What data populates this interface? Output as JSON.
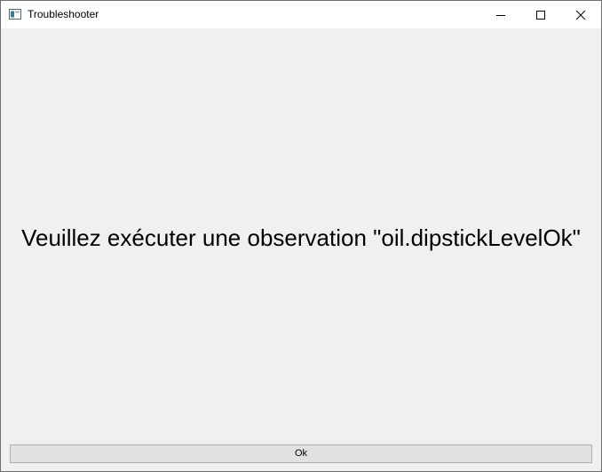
{
  "window": {
    "title": "Troubleshooter",
    "icon": "app-window-icon"
  },
  "titlebar_controls": {
    "minimize_icon": "minimize-icon",
    "maximize_icon": "maximize-icon",
    "close_icon": "close-icon"
  },
  "content": {
    "message": "Veuillez exécuter une observation \"oil.dipstickLevelOk\""
  },
  "buttons": {
    "ok_label": "Ok"
  },
  "colors": {
    "background": "#f0f0f0",
    "titlebar": "#ffffff",
    "button_face": "#e1e1e1",
    "button_border": "#adadad"
  }
}
